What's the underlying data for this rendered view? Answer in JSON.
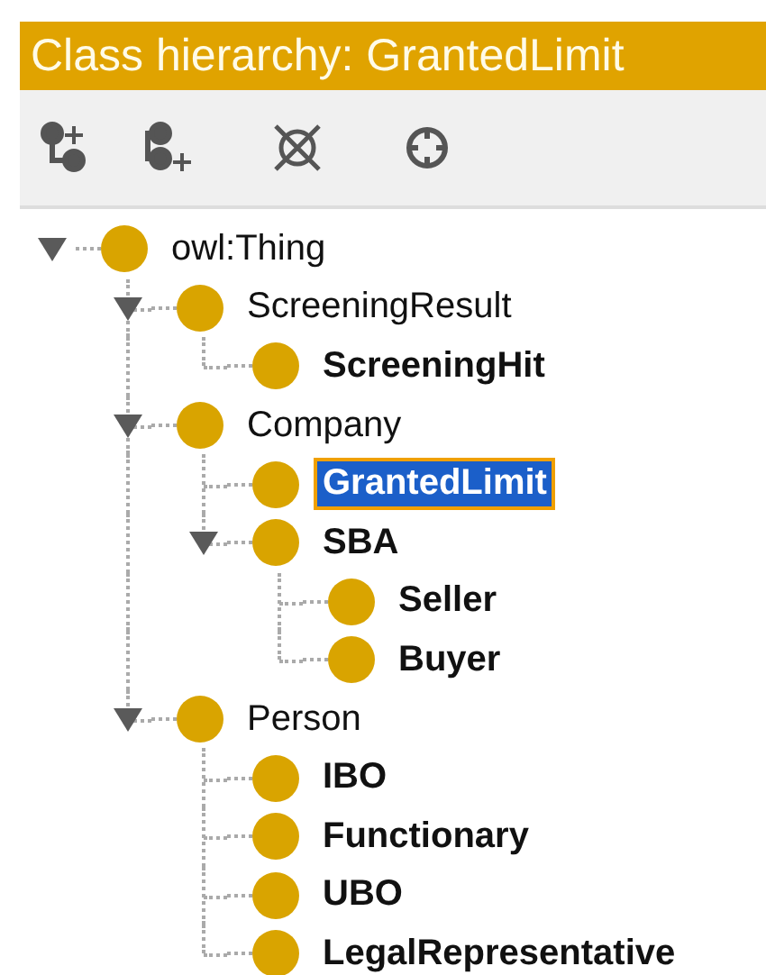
{
  "panel": {
    "title": "Class hierarchy: GrantedLimit"
  },
  "toolbar": [
    {
      "kind": "add_subclass"
    },
    {
      "kind": "add_sibling"
    },
    {
      "kind": "delete"
    },
    {
      "kind": "target"
    }
  ],
  "tree": [
    {
      "label": "owl:Thing",
      "bold": false,
      "selected": false,
      "expanded": true,
      "children": [
        {
          "label": "ScreeningResult",
          "bold": false,
          "selected": false,
          "expanded": true,
          "children": [
            {
              "label": "ScreeningHit",
              "bold": true,
              "selected": false
            }
          ]
        },
        {
          "label": "Company",
          "bold": false,
          "selected": false,
          "expanded": true,
          "children": [
            {
              "label": "GrantedLimit",
              "bold": true,
              "selected": true
            },
            {
              "label": "SBA",
              "bold": true,
              "selected": false,
              "expanded": true,
              "children": [
                {
                  "label": "Seller",
                  "bold": true,
                  "selected": false
                },
                {
                  "label": "Buyer",
                  "bold": true,
                  "selected": false
                }
              ]
            }
          ]
        },
        {
          "label": "Person",
          "bold": false,
          "selected": false,
          "expanded": true,
          "children": [
            {
              "label": "IBO",
              "bold": true,
              "selected": false
            },
            {
              "label": "Functionary",
              "bold": true,
              "selected": false
            },
            {
              "label": "UBO",
              "bold": true,
              "selected": false
            },
            {
              "label": "LegalRepresentative",
              "bold": true,
              "selected": false
            }
          ]
        }
      ]
    }
  ]
}
